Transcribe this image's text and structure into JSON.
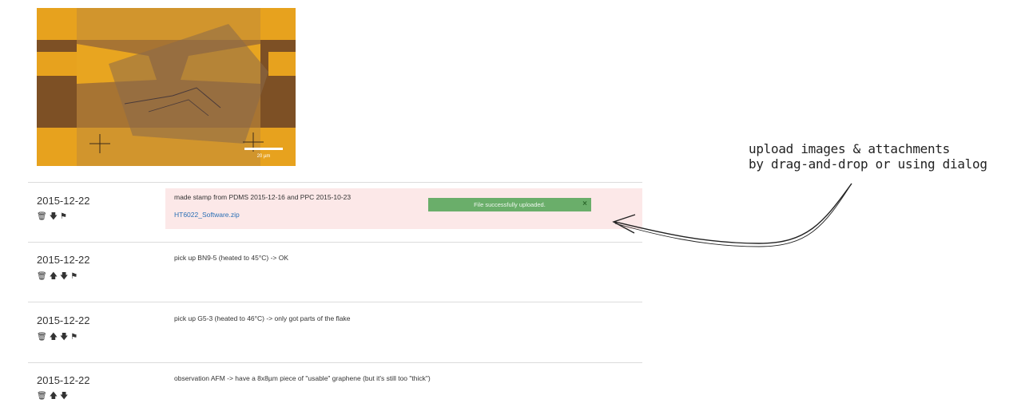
{
  "entries": [
    {
      "date": "2015-12-22",
      "text": "made stamp from PDMS 2015-12-16 and PPC 2015-10-23",
      "attachment": "HT6022_Software.zip",
      "toast": "File successfully uploaded.",
      "toast_close": "×"
    },
    {
      "date": "2015-12-22",
      "text": "pick up BN9-5 (heated to 45°C) -> OK"
    },
    {
      "date": "2015-12-22",
      "text": "pick up G5-3 (heated to 46°C) -> only got parts of the flake"
    },
    {
      "date": "2015-12-22",
      "text": "observation AFM -> have a 8x8µm piece of \"usable\" graphene (but it's still too \"thick\")"
    }
  ],
  "image": {
    "scale_bar_label": "20 µm"
  },
  "icons": {
    "trash": "🗑",
    "up": "🡅",
    "down": "🡇",
    "flag": "⚑"
  },
  "annotation": {
    "line1": "upload images & attachments",
    "line2": "by drag-and-drop or using dialog"
  },
  "colors": {
    "toast_bg": "#6aae6a",
    "highlight_bg": "#fce8e8",
    "link": "#2a6fb5"
  }
}
